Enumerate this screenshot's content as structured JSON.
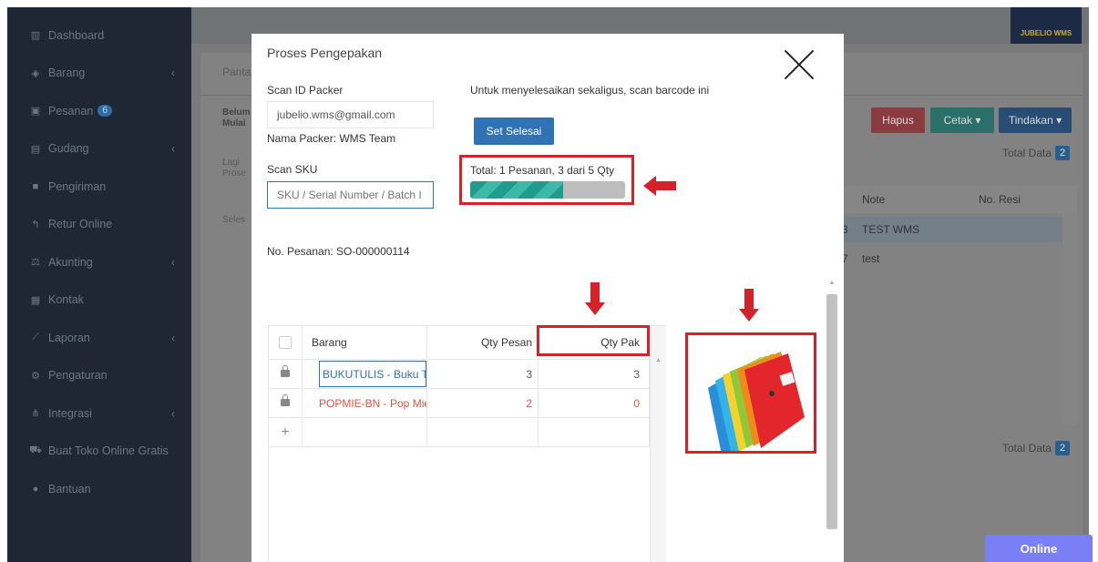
{
  "sidebar": {
    "items": [
      {
        "label": "Dashboard",
        "icon": "chart-bar-icon",
        "chevron": false
      },
      {
        "label": "Barang",
        "icon": "cubes-icon",
        "chevron": true
      },
      {
        "label": "Pesanan",
        "icon": "gift-icon",
        "chevron": false,
        "badge": "6"
      },
      {
        "label": "Gudang",
        "icon": "building-icon",
        "chevron": true
      },
      {
        "label": "Pengiriman",
        "icon": "truck-icon",
        "chevron": false
      },
      {
        "label": "Retur Online",
        "icon": "reply-icon",
        "chevron": false
      },
      {
        "label": "Akunting",
        "icon": "balance-scale-icon",
        "chevron": true
      },
      {
        "label": "Kontak",
        "icon": "address-card-icon",
        "chevron": false
      },
      {
        "label": "Laporan",
        "icon": "line-chart-icon",
        "chevron": true
      },
      {
        "label": "Pengaturan",
        "icon": "cogs-icon",
        "chevron": false
      },
      {
        "label": "Integrasi",
        "icon": "sitemap-icon",
        "chevron": true
      },
      {
        "label": "Buat Toko Online Gratis",
        "icon": "cart-icon",
        "chevron": false
      },
      {
        "label": "Bantuan",
        "icon": "question-circle-icon",
        "chevron": false
      }
    ]
  },
  "background": {
    "logo_text": "JUBELIO WMS",
    "tab_label": "Panta",
    "status_left_1": "Belum",
    "status_left_2": "Mulai",
    "status_left_3": "Lagi",
    "status_left_4": "Prose",
    "status_left_5": "Seles",
    "buttons": {
      "hapus": "Hapus",
      "cetak": "Cetak ▾",
      "tindakan": "Tindakan ▾"
    },
    "total_data_label": "Total Data",
    "total_data_value": "2",
    "table_headers": {
      "note": "Note",
      "resi": "No. Resi"
    },
    "rows": [
      {
        "prefix": "3",
        "note": "TEST WMS"
      },
      {
        "prefix": "7",
        "note": "test"
      }
    ],
    "online_label": "Online"
  },
  "modal": {
    "title": "Proses Pengepakan",
    "scan_packer_label": "Scan ID Packer",
    "packer_value": "jubelio.wms@gmail.com",
    "packer_name": "Nama Packer: WMS Team",
    "finish_instruction": "Untuk menyelesaikan sekaligus, scan barcode ini",
    "set_selesai_label": "Set Selesai",
    "scan_sku_label": "Scan SKU",
    "sku_placeholder": "SKU / Serial Number / Batch I",
    "progress_text": "Total: 1 Pesanan, 3 dari 5 Qty",
    "progress_fraction": 0.6,
    "order_no": "No. Pesanan: SO-000000114",
    "table": {
      "headers": {
        "barang": "Barang",
        "qty_pesan": "Qty Pesan",
        "qty_pak": "Qty Pak"
      },
      "rows": [
        {
          "barang": "BUKUTULIS - Buku Tu",
          "qty_pesan": "3",
          "qty_pak": "3",
          "highlight": false
        },
        {
          "barang": "POPMIE-BN - Pop Mie",
          "qty_pesan": "2",
          "qty_pak": "0",
          "highlight": true
        }
      ],
      "add_symbol": "+"
    },
    "product_image": "colorful-notebooks-image"
  },
  "colors": {
    "annotation_red": "#d4212a",
    "primary_blue": "#2f73b5",
    "progress_teal": "#1e9c8d",
    "pending_red": "#e2553f"
  }
}
